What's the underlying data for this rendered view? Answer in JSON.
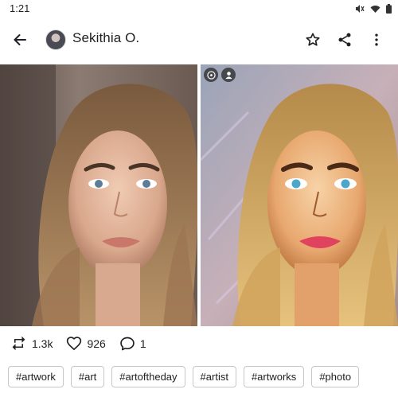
{
  "status": {
    "time": "1:21"
  },
  "header": {
    "user_name": "Sekithia O."
  },
  "stats": {
    "reposts": "1.3k",
    "likes": "926",
    "comments": "1"
  },
  "tags": [
    "#artwork",
    "#art",
    "#artoftheday",
    "#artist",
    "#artworks",
    "#photo"
  ],
  "icons": {
    "back": "arrow-back-icon",
    "star": "star-outline-icon",
    "share": "share-icon",
    "more": "more-vert-icon",
    "repost": "repost-icon",
    "like": "heart-outline-icon",
    "comment": "comment-icon"
  }
}
